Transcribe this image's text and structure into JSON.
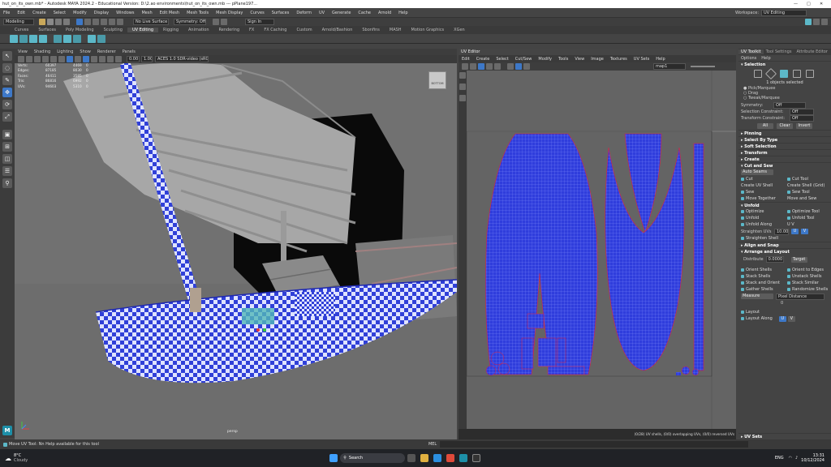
{
  "titlebar": {
    "title": "hut_on_its_own.mb* - Autodesk MAYA 2024.2 - Educational Version: D:\\2.ao environments\\hut_on_its_own.mb  ---  pPlane197...",
    "min": "—",
    "max": "□",
    "close": "✕"
  },
  "menu": {
    "items": [
      "File",
      "Edit",
      "Create",
      "Select",
      "Modify",
      "Display",
      "Windows",
      "Mesh",
      "Edit Mesh",
      "Mesh Tools",
      "Mesh Display",
      "Curves",
      "Surfaces",
      "Deform",
      "UV",
      "Generate",
      "Cache",
      "Arnold",
      "Help"
    ],
    "workspace_label": "Workspace:",
    "workspace_value": "UV Editing"
  },
  "statusline": {
    "mode": "Modeling",
    "live": "No Live Surface",
    "symmetry": "Symmetry: Off",
    "signin": "Sign In"
  },
  "shelf": {
    "tabs": [
      "Curves",
      "Surfaces",
      "Poly Modeling",
      "Sculpting",
      "UV Editing",
      "Rigging",
      "Animation",
      "Rendering",
      "FX",
      "FX Caching",
      "Custom",
      "Arnold/Bashion",
      "Sbonfins",
      "MASH",
      "Motion Graphics",
      "XGen"
    ],
    "active": "UV Editing"
  },
  "viewport": {
    "menu": [
      "View",
      "Shading",
      "Lighting",
      "Show",
      "Renderer",
      "Panels"
    ],
    "field1": "0.00",
    "field2": "1.00",
    "colorspace": "ACES 1.0 SDR-video (sRGB)",
    "camera": "persp",
    "cube_label": "BOTTOM",
    "hud": [
      [
        "Verts:",
        "60397",
        "4469",
        "0"
      ],
      [
        "Edges:",
        "87185",
        "8030",
        "0"
      ],
      [
        "Faces:",
        "46411",
        "3585",
        "0"
      ],
      [
        "Tris:",
        "86816",
        "6992",
        "0"
      ],
      [
        "UVs:",
        "94603",
        "5310",
        "0"
      ]
    ]
  },
  "uv_editor": {
    "title": "UV Editor",
    "menu": [
      "Edit",
      "Create",
      "Select",
      "Cut/Sew",
      "Modify",
      "Tools",
      "View",
      "Image",
      "Textures",
      "UV Sets",
      "Help"
    ],
    "map": "map1",
    "footer": "(0/28) UV shells, (0/0) overlapping UVs, (0/0) reversed UVs"
  },
  "uv_toolkit": {
    "tabs": [
      "UV Toolkit",
      "Tool Settings",
      "Attribute Editor"
    ],
    "menu": [
      "Options",
      "Help"
    ],
    "selection_header": "Selection",
    "selected_text": "1 objects selected",
    "modes": [
      "Pick/Marquee",
      "Drag",
      "Tweak/Marquee"
    ],
    "symmetry_label": "Symmetry:",
    "symmetry_value": "Off",
    "constraint_label": "Selection Constraint:",
    "constraint_value": "Off",
    "transform_label": "Transform Constraint:",
    "transform_value": "Off",
    "sel_buttons": [
      "All",
      "Clear",
      "Invert"
    ],
    "sub_sections": [
      "Pinning",
      "Select By Type",
      "Soft Selection",
      "Transform",
      "Create",
      "Cut and Sew"
    ],
    "auto_seams": "Auto Seams",
    "cut_sew": [
      [
        "Cut",
        "Cut Tool"
      ],
      [
        "Create UV Shell",
        "Create Shell (Grid)"
      ],
      [
        "Sew",
        "Sew Tool"
      ],
      [
        "Move Together",
        "Move and Sew"
      ]
    ],
    "unfold_header": "Unfold",
    "unfold": [
      [
        "Optimize",
        "Optimize Tool"
      ],
      [
        "Unfold",
        "Unfold Tool"
      ],
      [
        "Unfold Along",
        "U  V"
      ]
    ],
    "straighten_label": "Straighten UVs",
    "straighten_value": "10.00",
    "uv_u": "U",
    "uv_v": "V",
    "straighten_shell": "Straighten Shell",
    "align_header": "Align and Snap",
    "arrange_header": "Arrange and Layout",
    "distribute_label": "Distribute",
    "distribute_value": "0.0000",
    "target": "Target",
    "arrange": [
      [
        "Orient Shells",
        "Orient to Edges"
      ],
      [
        "Stack Shells",
        "Unstack Shells"
      ],
      [
        "Stack and Orient",
        "Stack Similar"
      ],
      [
        "Gather Shells",
        "Randomize Shells"
      ]
    ],
    "measure_label": "Measure",
    "measure_value": "Pixel Distance",
    "measure_num": "0",
    "layout": "Layout",
    "layout_along": "Layout Along",
    "footer": "UV Sets"
  },
  "helpline": {
    "text": "Move UV Tool: Nn Help available for this tool",
    "mel": "MEL"
  },
  "taskbar": {
    "temp": "8°C",
    "weather": "Cloudy",
    "search": "Search",
    "lang": "ENG",
    "time": "13:31",
    "date": "10/12/2024"
  },
  "colors": {
    "uv_blue": "#2f3ddc",
    "accent": "#5cb8c8",
    "highlight": "#3d78c8"
  }
}
